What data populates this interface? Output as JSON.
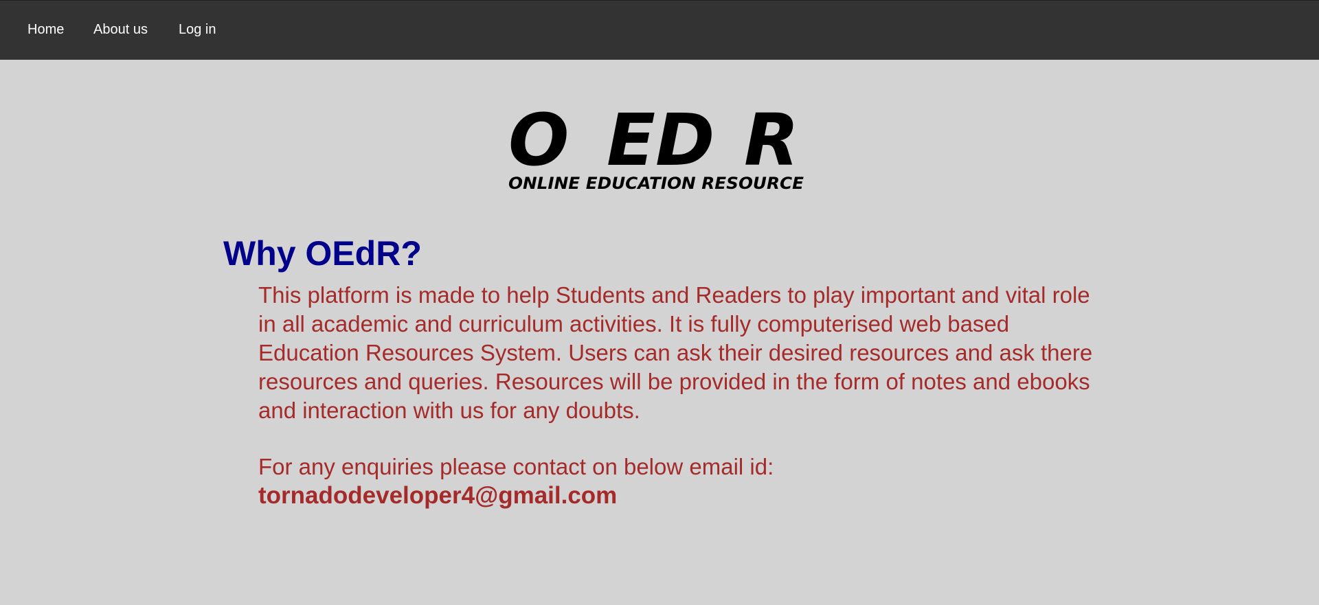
{
  "nav": {
    "items": [
      {
        "label": "Home"
      },
      {
        "label": "About us"
      },
      {
        "label": "Log in"
      }
    ]
  },
  "logo": {
    "letters": [
      "O",
      "ED",
      "R"
    ],
    "tagline": "ONLINE EDUCATION RESOURCE"
  },
  "main": {
    "heading": "Why OEdR?",
    "description": "This platform is made to help Students and Readers to play important and vital role in all academic and curriculum activities. It is fully computerised web based Education Resources System. Users can ask their desired resources and ask there resources and queries. Resources will be provided in the form of notes and ebooks and interaction with us for any doubts.",
    "enquiry_text": "For any enquiries please contact on below email id:",
    "email": "tornadodeveloper4@gmail.com"
  },
  "colors": {
    "page_background": "#d3d3d3",
    "navbar_background": "#333333",
    "nav_text": "#ffffff",
    "heading": "#00008b",
    "body_text": "#a52a2a",
    "logo": "#000000"
  }
}
